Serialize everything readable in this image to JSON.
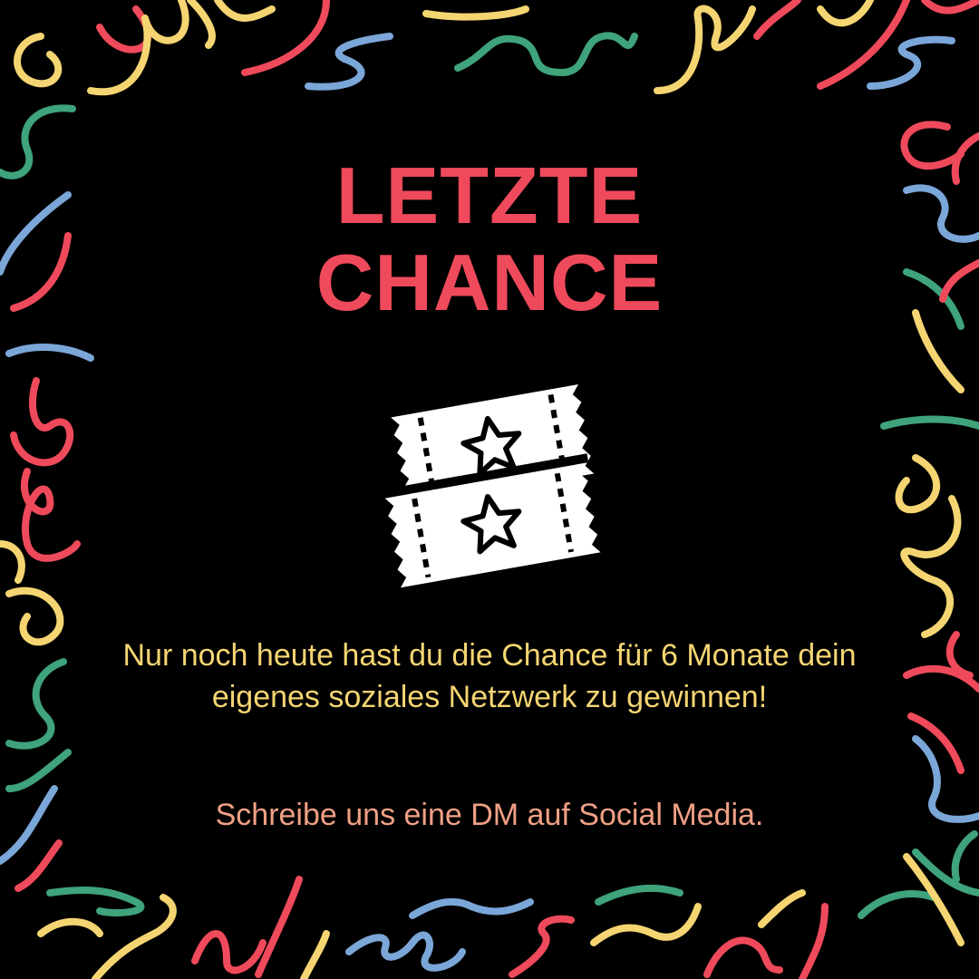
{
  "colors": {
    "background": "#000000",
    "title": "#ef4a5b",
    "body": "#f5d572",
    "cta": "#f0a085",
    "icon": "#ffffff",
    "confetti_red": "#ef4a5b",
    "confetti_yellow": "#f5d572",
    "confetti_green": "#3fa37c",
    "confetti_blue": "#7ba6d8"
  },
  "title": {
    "line1": "LETZTE",
    "line2": "CHANCE"
  },
  "icon": {
    "name": "tickets-icon"
  },
  "body": {
    "text": "Nur noch heute hast du die Chance für 6 Monate dein eigenes soziales Netzwerk zu gewinnen!"
  },
  "cta": {
    "text": "Schreibe uns eine DM auf Social Media."
  }
}
